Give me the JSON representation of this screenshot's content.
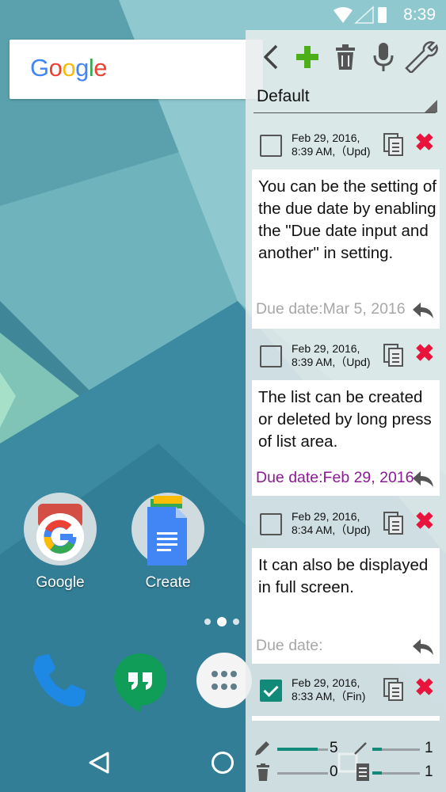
{
  "status": {
    "time": "8:39"
  },
  "home": {
    "search_logo": "Google",
    "apps": [
      {
        "label": "Google",
        "icon": "google-app-icon"
      },
      {
        "label": "Create",
        "icon": "docs-create-icon"
      }
    ],
    "dock": [
      "phone-icon",
      "hangouts-icon",
      "app-drawer-icon"
    ]
  },
  "toolbar": {
    "icons": [
      "back-icon",
      "add-icon",
      "trash-icon",
      "mic-icon",
      "wrench-icon"
    ]
  },
  "list_selector": {
    "value": "Default"
  },
  "items": [
    {
      "date_line1": "Feb 29, 2016,",
      "date_line2": "8:39 AM,（Upd)",
      "checked": false,
      "text": "You can be the setting of the due date by enabling the \"Due date input and another\" in setting.",
      "due": "Due date:Mar 5, 2016",
      "due_color": "#a7a7a7"
    },
    {
      "date_line1": "Feb 29, 2016,",
      "date_line2": "8:39 AM,（Upd)",
      "checked": false,
      "text": "The list can be created or deleted by long press of list area.",
      "due": "Due date:Feb 29, 2016",
      "due_color": "#8b1a94"
    },
    {
      "date_line1": "Feb 29, 2016,",
      "date_line2": "8:34 AM,（Upd)",
      "checked": false,
      "text": "It can also be displayed in full screen.",
      "due": "Due date:",
      "due_color": "#a7a7a7"
    },
    {
      "date_line1": "Feb 29, 2016,",
      "date_line2": "8:33 AM,（Fin)",
      "checked": true
    }
  ],
  "footer": {
    "pending_count": "5",
    "done_count": "1",
    "deleted_count": "0",
    "doc_count": "1",
    "pending_progress": 0.8,
    "done_progress": 0.2,
    "deleted_progress": 0.0,
    "doc_progress": 0.2
  },
  "colors": {
    "accent": "#128a7a",
    "delete": "#e8143c",
    "add": "#4caf1a"
  }
}
